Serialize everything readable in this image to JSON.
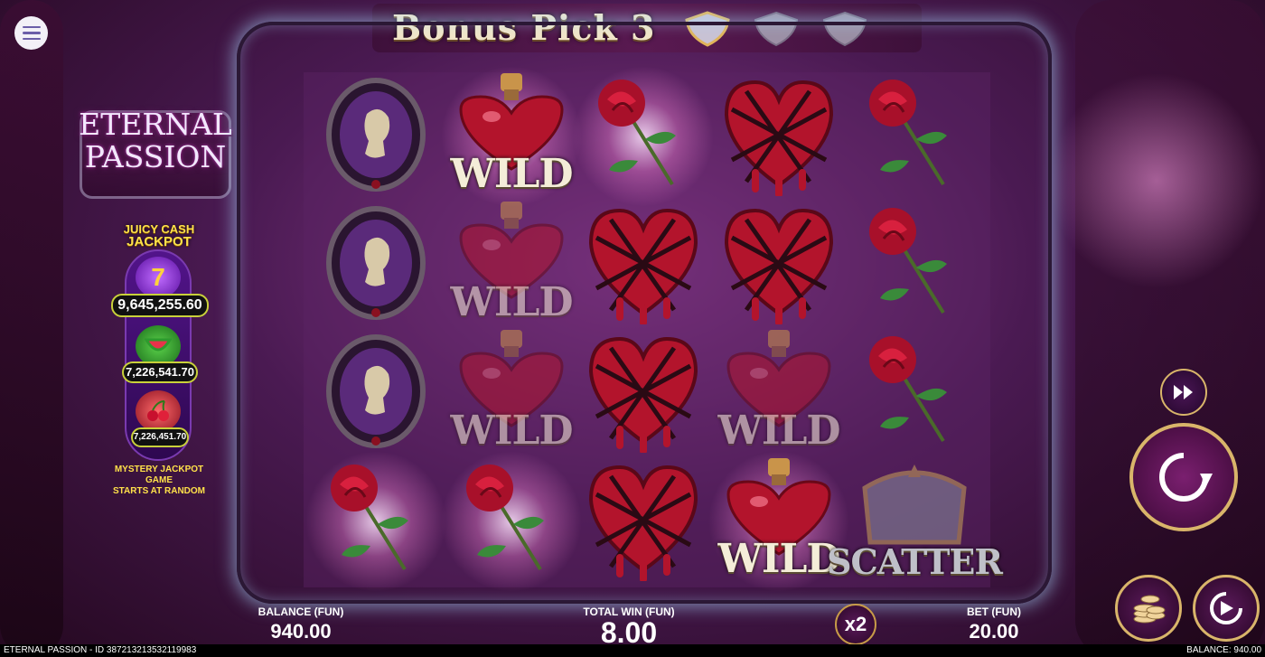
{
  "bonus": {
    "title": "Bonus Pick 3",
    "picks_filled": 1,
    "picks_total": 3
  },
  "logo": {
    "line1": "ETERNAL",
    "line2": "PASSION"
  },
  "jackpot": {
    "title_line1": "JUICY CASH",
    "title_line2": "JACKPOT",
    "tiers": [
      {
        "icon": "seven-icon",
        "value": "9,645,255.60"
      },
      {
        "icon": "watermelon-icon",
        "value": "7,226,541.70"
      },
      {
        "icon": "cherry-icon",
        "value": "7,226,451.70"
      }
    ],
    "note_line1": "MYSTERY JACKPOT GAME",
    "note_line2": "STARTS AT RANDOM"
  },
  "reels": [
    [
      "cameo",
      "cameo",
      "cameo",
      "rose"
    ],
    [
      "wild",
      "wild",
      "wild",
      "rose"
    ],
    [
      "rose",
      "heart",
      "heart",
      "heart"
    ],
    [
      "heart",
      "heart",
      "wild",
      "wild"
    ],
    [
      "rose",
      "rose",
      "rose",
      "scatter"
    ]
  ],
  "highlighted": [
    "0-3",
    "1-0",
    "2-0",
    "3-3",
    "1-3"
  ],
  "symbol_labels": {
    "wild": "WILD",
    "scatter": "SCATTER"
  },
  "info": {
    "balance_label": "BALANCE (FUN)",
    "balance_value": "940.00",
    "win_label": "TOTAL WIN (FUN)",
    "win_value": "8.00",
    "bet_label": "BET (FUN)",
    "bet_value": "20.00",
    "multiplier": "x2"
  },
  "footer": {
    "left": "ETERNAL PASSION - ID 387213213532119983",
    "right": "BALANCE: 940.00"
  },
  "colors": {
    "accent_gold": "#d9b56a",
    "jackpot_yellow": "#ffe14a",
    "heart_red": "#b3142c"
  }
}
